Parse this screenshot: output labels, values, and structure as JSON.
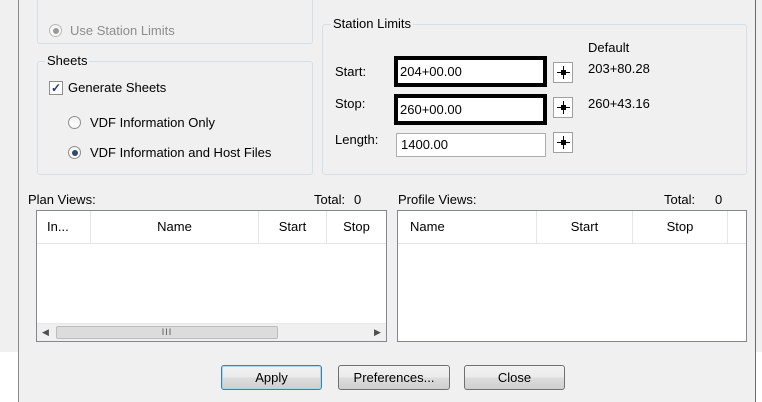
{
  "limits_group": {
    "use_station_limits_label": "Use Station Limits"
  },
  "sheets": {
    "title": "Sheets",
    "generate_sheets_label": "Generate Sheets",
    "generate_sheets_checked": true,
    "option_vdf_only": "VDF Information Only",
    "option_vdf_host": "VDF Information and Host Files",
    "selected_option": "VDF Information and Host Files"
  },
  "station_limits": {
    "title": "Station Limits",
    "default_header": "Default",
    "start_label": "Start:",
    "start_value": "204+00.00",
    "start_default": "203+80.28",
    "stop_label": "Stop:",
    "stop_value": "260+00.00",
    "stop_default": "260+43.16",
    "length_label": "Length:",
    "length_value": "1400.00",
    "pick_icon": "crosshair-icon"
  },
  "plan_views": {
    "title": "Plan Views:",
    "total_label": "Total:",
    "total_value": "0",
    "columns": [
      "In...",
      "Name",
      "Start",
      "Stop"
    ],
    "scroll_thumb_glyph": "III"
  },
  "profile_views": {
    "title": "Profile Views:",
    "total_label": "Total:",
    "total_value": "0",
    "columns": [
      "Name",
      "Start",
      "Stop"
    ]
  },
  "buttons": {
    "apply": "Apply",
    "preferences": "Preferences...",
    "close": "Close"
  }
}
